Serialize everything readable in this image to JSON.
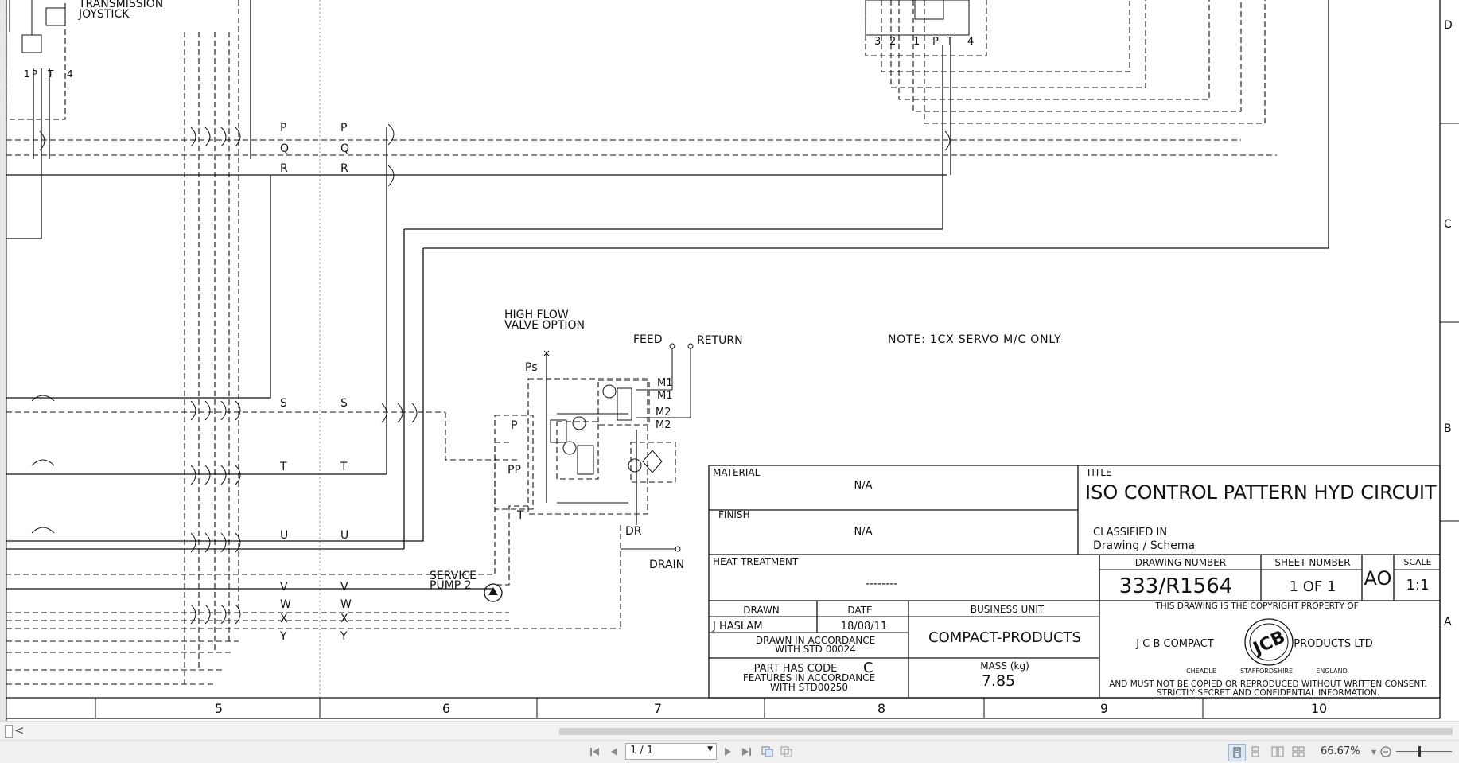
{
  "window": {
    "title": ""
  },
  "drawing": {
    "top_labels": {
      "transmission_joystick": [
        "TRANSMISSION",
        "JOYSTICK"
      ]
    },
    "ports_top_left": [
      "1",
      "P",
      "T",
      "4"
    ],
    "ports_top_right": [
      "3",
      "2",
      "1",
      "P",
      "T",
      "4"
    ],
    "bus_labels_left": [
      "P",
      "Q",
      "R",
      "S",
      "T",
      "U",
      "V",
      "W",
      "X",
      "Y"
    ],
    "bus_labels_right": [
      "P",
      "Q",
      "R",
      "S",
      "T",
      "U",
      "V",
      "W",
      "X",
      "Y"
    ],
    "high_flow_option": [
      "HIGH FLOW",
      "VALVE OPTION"
    ],
    "feed_label": "FEED",
    "return_label": "RETURN",
    "note": "NOTE: 1CX SERVO M/C ONLY",
    "valve_labels": {
      "ps": "Ps",
      "p": "P",
      "pp": "PP",
      "t": "T",
      "m1a": "M1",
      "m1b": "M1",
      "m2a": "M2",
      "m2b": "M2",
      "dr": "DR"
    },
    "drain_label": "DRAIN",
    "service_pump": [
      "SERVICE",
      "PUMP 2"
    ],
    "row_letters": [
      "D",
      "C",
      "B",
      "A"
    ],
    "column_numbers": [
      "5",
      "6",
      "7",
      "8",
      "9",
      "10"
    ]
  },
  "title_block": {
    "material_label": "MATERIAL",
    "material_value": "N/A",
    "finish_label": "FINISH",
    "finish_value": "N/A",
    "heat_label": "HEAT TREATMENT",
    "heat_value": "--------",
    "title_label": "TITLE",
    "title_value": "ISO CONTROL PATTERN HYD CIRCUIT",
    "classified_label": "CLASSIFIED IN",
    "classified_value": "Drawing / Schema",
    "drawing_number_label": "DRAWING NUMBER",
    "drawing_number_value": "333/R1564",
    "sheet_number_label": "SHEET NUMBER",
    "sheet_number_value": "1 OF 1",
    "size_value": "AO",
    "scale_label": "SCALE",
    "scale_value": "1:1",
    "drawn_label": "DRAWN",
    "date_label": "DATE",
    "drawn_value": "J HASLAM",
    "date_value": "18/08/11",
    "drawn_std": [
      "DRAWN IN ACCORDANCE",
      "WITH STD 00024"
    ],
    "business_unit_label": "BUSINESS UNIT",
    "business_unit_value": "COMPACT-PRODUCTS",
    "part_code": [
      "PART HAS CODE",
      "C",
      "FEATURES IN ACCORDANCE",
      "WITH STD00250"
    ],
    "mass_label": "MASS (kg)",
    "mass_value": "7.85",
    "copyright_line": "THIS DRAWING IS THE COPYRIGHT PROPERTY OF",
    "company_left": "J C B COMPACT",
    "company_right": "PRODUCTS LTD",
    "logo_text": "JCB",
    "locations": [
      "CHEADLE",
      "STAFFORDSHIRE",
      "ENGLAND"
    ],
    "notice": [
      "AND MUST NOT BE COPIED OR REPRODUCED WITHOUT WRITTEN CONSENT.",
      "STRICTLY SECRET AND CONFIDENTIAL INFORMATION."
    ]
  },
  "viewer": {
    "scroll_left_glyph": "<",
    "nav_first_icon": "first-page-icon",
    "nav_prev_icon": "previous-page-icon",
    "page_value": "1 / 1",
    "nav_next_icon": "next-page-icon",
    "nav_last_icon": "last-page-icon",
    "zoom_value": "66.67%"
  }
}
